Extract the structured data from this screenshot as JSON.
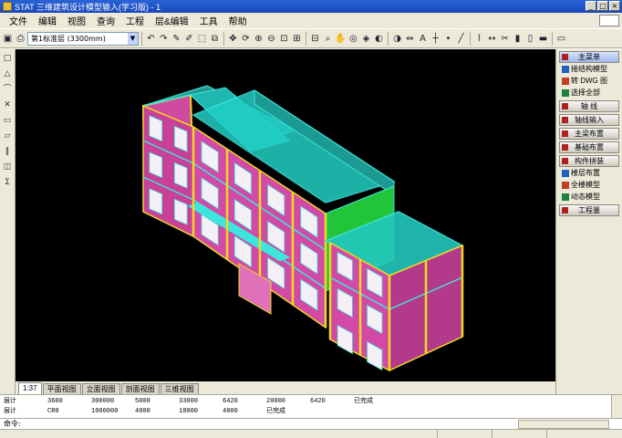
{
  "window": {
    "title": "STAT 三维建筑设计模型输入(学习版) - 1",
    "minimize": "_",
    "maximize": "□",
    "close": "×"
  },
  "menu": [
    "文件",
    "编辑",
    "视图",
    "查询",
    "工程",
    "层&编辑",
    "工具",
    "帮助"
  ],
  "toolbar": {
    "layer_select": "第1标准层 (3300mm)",
    "icons": [
      "save-icon",
      "print-icon",
      "undo-icon",
      "redo-icon",
      "brush-icon",
      "pen-icon",
      "select-icon",
      "copy-icon",
      "move-icon",
      "rotate-icon",
      "zoom-in-icon",
      "zoom-out-icon",
      "zoom-window-icon",
      "zoom-all-icon",
      "zoom-prev-icon",
      "zoom-realtime-icon",
      "pan-icon",
      "orbit-icon",
      "view-3d-icon",
      "hide-icon",
      "render-icon",
      "measure-icon",
      "text-icon",
      "axis-icon",
      "point-icon",
      "line-icon",
      "polyline-icon",
      "dim-icon",
      "cut-icon",
      "column-icon",
      "wall-icon",
      "beam-icon",
      "slab-icon"
    ]
  },
  "left_tools": [
    "□",
    "△",
    "⌒",
    "✕",
    "▭",
    "▱",
    "‖",
    "◫",
    "Σ"
  ],
  "right_panel": {
    "sections": [
      {
        "label": "主菜单",
        "active": true,
        "items": [
          "接结构模型",
          "转 DWG 图",
          "选择全部"
        ]
      },
      {
        "label": "轴 线",
        "active": false,
        "items": []
      },
      {
        "label": "轴线输入",
        "active": false,
        "items": []
      },
      {
        "label": "主梁布置",
        "active": false,
        "items": []
      },
      {
        "label": "基础布置",
        "active": false,
        "items": []
      },
      {
        "label": "构件拼装",
        "active": false,
        "items": [
          "楼层布置",
          "全楼模型",
          "动态模型"
        ]
      },
      {
        "label": "工程量",
        "active": false,
        "items": []
      }
    ]
  },
  "tabs": [
    {
      "label": "1:37",
      "active": true
    },
    {
      "label": "平面视图",
      "active": false
    },
    {
      "label": "立面视图",
      "active": false
    },
    {
      "label": "剖面视图",
      "active": false
    },
    {
      "label": "三维视图",
      "active": false
    }
  ],
  "output_lines": [
    [
      "层计",
      "3600",
      "300000",
      "5000",
      "33000",
      "6420",
      "20000",
      "6420",
      "已完成"
    ],
    [
      "层计",
      "CR0",
      "1000000",
      "4000",
      "18000",
      "4000",
      "已完成"
    ]
  ],
  "command": {
    "prompt": "命令:",
    "value": ""
  },
  "colors": {
    "viewport_bg": "#000000",
    "wall_pink": "#e44aa6",
    "slab_cyan": "#3ce6dc",
    "column_yellow": "#f0d820",
    "glass_green": "#22c43a"
  }
}
